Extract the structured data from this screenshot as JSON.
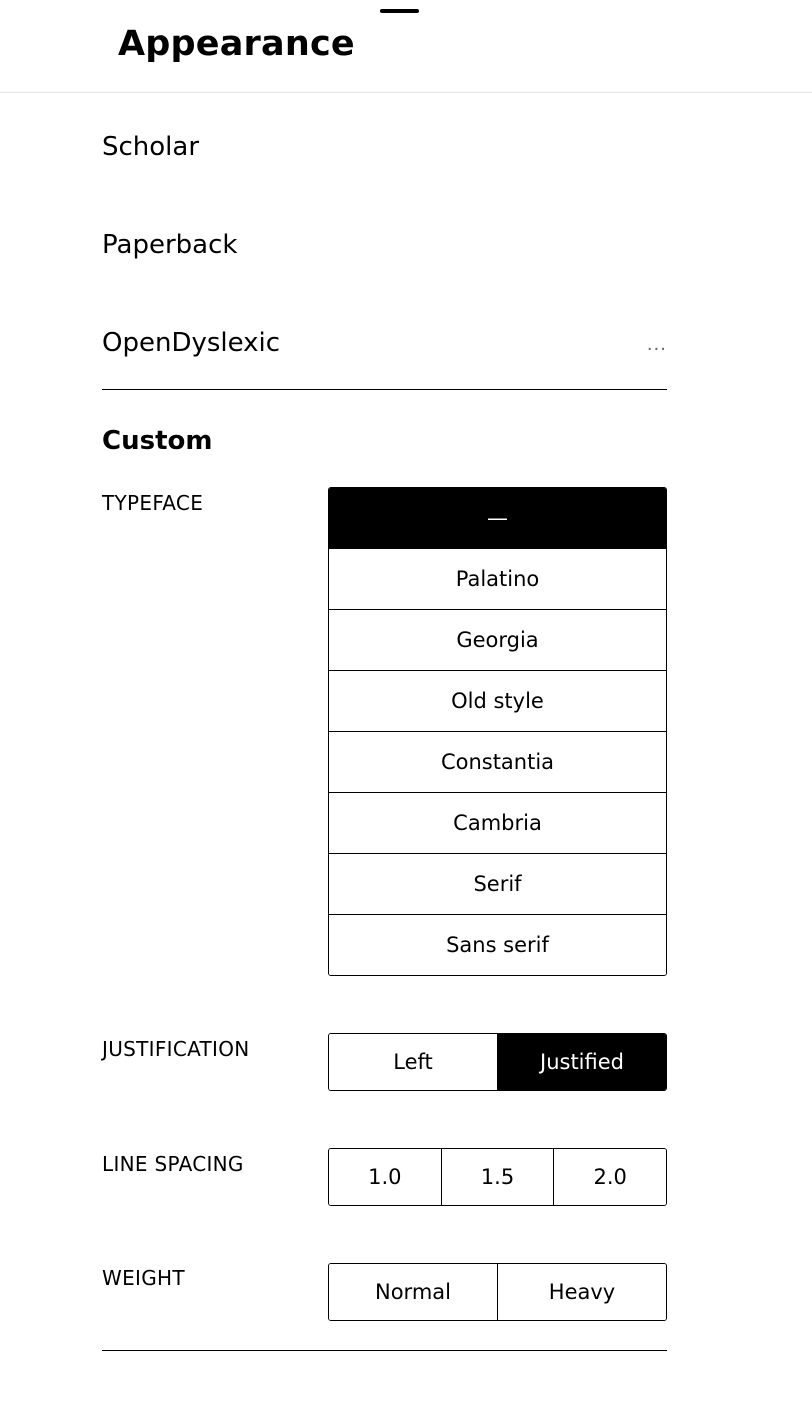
{
  "header": {
    "title": "Appearance"
  },
  "presets": [
    {
      "label": "Scholar"
    },
    {
      "label": "Paperback"
    },
    {
      "label": "OpenDyslexic",
      "more": "..."
    }
  ],
  "custom": {
    "title": "Custom",
    "typeface": {
      "label": "TYPEFACE",
      "options": [
        "—",
        "Palatino",
        "Georgia",
        "Old style",
        "Constantia",
        "Cambria",
        "Serif",
        "Sans serif"
      ],
      "selected": "—"
    },
    "justification": {
      "label": "JUSTIFICATION",
      "options": [
        "Left",
        "Justified"
      ],
      "selected": "Justified"
    },
    "line_spacing": {
      "label": "LINE SPACING",
      "options": [
        "1.0",
        "1.5",
        "2.0"
      ],
      "selected": null
    },
    "weight": {
      "label": "WEIGHT",
      "options": [
        "Normal",
        "Heavy"
      ],
      "selected": null
    }
  },
  "colors": {
    "selected_bg": "#000000",
    "selected_fg": "#ffffff",
    "border": "#000000"
  }
}
